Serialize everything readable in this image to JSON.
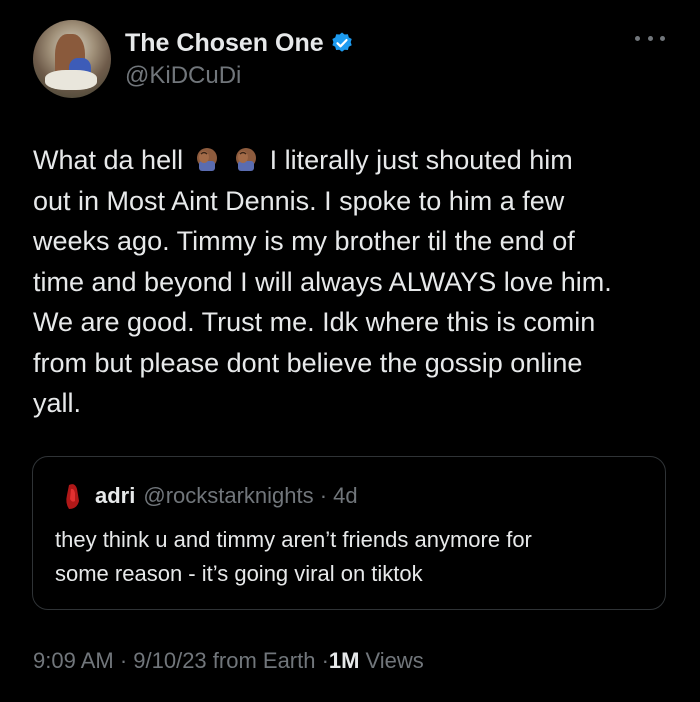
{
  "author": {
    "display_name": "The Chosen One",
    "handle": "@KiDCuDi",
    "verified_color": "#1d9bf0"
  },
  "tweet": {
    "lines": [
      [
        "What da hell",
        "I literally just shouted him"
      ],
      "out in Most Aint Dennis.  I spoke to him a few",
      "weeks ago.  Timmy is my brother til the end of",
      "time and beyond I will always ALWAYS love him.",
      "We are good.  Trust me.  Idk where this is comin",
      "from but please dont believe the gossip online",
      "yall."
    ],
    "emojis": [
      "facepalm-emoji",
      "facepalm-emoji"
    ]
  },
  "quote": {
    "name": "adri",
    "handle_time": "@rockstarknights · 4d",
    "lines": [
      "they think u and timmy aren’t friends anymore for",
      "some reason - it’s going viral on tiktok"
    ]
  },
  "footer": {
    "meta": "9:09 AM · 9/10/23 from Earth · ",
    "views_count": "1M",
    "views_label": "Views"
  },
  "icons": {
    "more": "more-horizontal-icon",
    "verified": "verified-badge-icon"
  }
}
